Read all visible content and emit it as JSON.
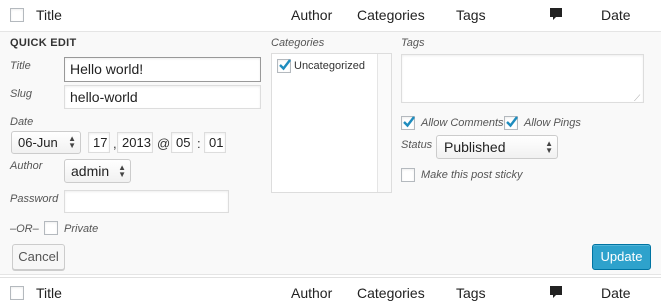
{
  "columns": {
    "title": "Title",
    "author": "Author",
    "categories": "Categories",
    "tags": "Tags",
    "date": "Date"
  },
  "quick_edit": {
    "heading": "QUICK EDIT",
    "title_label": "Title",
    "title_value": "Hello world!",
    "slug_label": "Slug",
    "slug_value": "hello-world",
    "date_label": "Date",
    "date_month": "06-Jun",
    "date_day": "17",
    "date_year": "2013",
    "at_sep": "@",
    "hour": "05",
    "time_sep": ":",
    "minute": "01",
    "day_year_sep": ",",
    "author_label": "Author",
    "author_value": "admin",
    "password_label": "Password",
    "password_value": "",
    "or_label": "–OR–",
    "private_label": "Private",
    "categories_label": "Categories",
    "categories_items": [
      {
        "label": "Uncategorized",
        "checked": true
      }
    ],
    "tags_label": "Tags",
    "tags_value": "",
    "allow_comments_label": "Allow Comments",
    "allow_comments_checked": true,
    "allow_pings_label": "Allow Pings",
    "allow_pings_checked": true,
    "status_label": "Status",
    "status_value": "Published",
    "sticky_label": "Make this post sticky",
    "sticky_checked": false,
    "cancel_label": "Cancel",
    "update_label": "Update"
  },
  "colors": {
    "primary": "#2ea2cc",
    "check": "#1e8cbe"
  },
  "icons": {
    "comments": "comment-bubble-icon",
    "check": "checkmark-icon",
    "select_arrow": "updown-arrows-icon"
  }
}
